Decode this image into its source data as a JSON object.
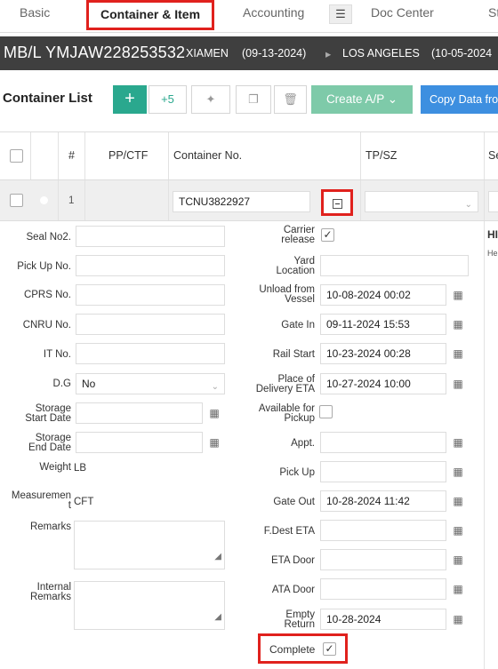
{
  "tabs": {
    "basic": "Basic",
    "container_item": "Container & Item",
    "accounting": "Accounting",
    "filter_icon": "sliders-icon",
    "doc_center": "Doc Center",
    "next": "St"
  },
  "header": {
    "mbl": "MB/L YMJAW228253532",
    "origin": "XIAMEN",
    "origin_date": "(09-13-2024)",
    "arrow": "▸",
    "destination": "LOS ANGELES",
    "dest_date": "(10-05-2024"
  },
  "toolbar": {
    "title": "Container List",
    "add_label": "+",
    "plus5_label": "+5",
    "create_ap_label": "Create A/P",
    "create_ap_caret": "⌄",
    "copy_data_label": "Copy Data fro"
  },
  "grid": {
    "columns": {
      "num": "#",
      "pp_ctf": "PP/CTF",
      "container_no": "Container No.",
      "tp_sz": "TP/SZ",
      "next": "Se"
    },
    "row": {
      "index": "1",
      "container_no": "TCNU3822927"
    }
  },
  "detail": {
    "left": {
      "seal_no2": "Seal No2.",
      "pick_up_no": "Pick Up No.",
      "cprs_no": "CPRS No.",
      "cnru_no": "CNRU No.",
      "it_no": "IT No.",
      "dg": "D.G",
      "dg_value": "No",
      "storage_start_1": "Storage",
      "storage_start_2": "Start Date",
      "storage_end_1": "Storage",
      "storage_end_2": "End Date",
      "weight": "Weight",
      "weight_unit": "LB",
      "measurement_1": "Measuremen",
      "measurement_2": "t",
      "measurement_unit": "CFT",
      "remarks": "Remarks",
      "internal_remarks_1": "Internal",
      "internal_remarks_2": "Remarks"
    },
    "right": {
      "carrier_release_1": "Carrier",
      "carrier_release_2": "release",
      "carrier_release_checked": true,
      "yard_location_1": "Yard",
      "yard_location_2": "Location",
      "unload_1": "Unload from",
      "unload_2": "Vessel",
      "unload_value": "10-08-2024 00:02",
      "gate_in": "Gate In",
      "gate_in_value": "09-11-2024 15:53",
      "rail_start": "Rail Start",
      "rail_start_value": "10-23-2024 00:28",
      "pod_eta_1": "Place of",
      "pod_eta_2": "Delivery ETA",
      "pod_eta_value": "10-27-2024 10:00",
      "avail_1": "Available for",
      "avail_2": "Pickup",
      "appt": "Appt.",
      "pick_up": "Pick Up",
      "gate_out": "Gate Out",
      "gate_out_value": "10-28-2024 11:42",
      "fdest_eta": "F.Dest ETA",
      "eta_door": "ETA Door",
      "ata_door": "ATA Door",
      "empty_return_1": "Empty",
      "empty_return_2": "Return",
      "empty_return_value": "10-28-2024",
      "complete": "Complete",
      "complete_checked": true
    },
    "side": {
      "h": "HI",
      "sub": "He"
    }
  },
  "colors": {
    "highlight": "#e0211d",
    "header_bg": "#3f3f3f",
    "green": "#2aa88e",
    "blue": "#3d8fe0"
  }
}
